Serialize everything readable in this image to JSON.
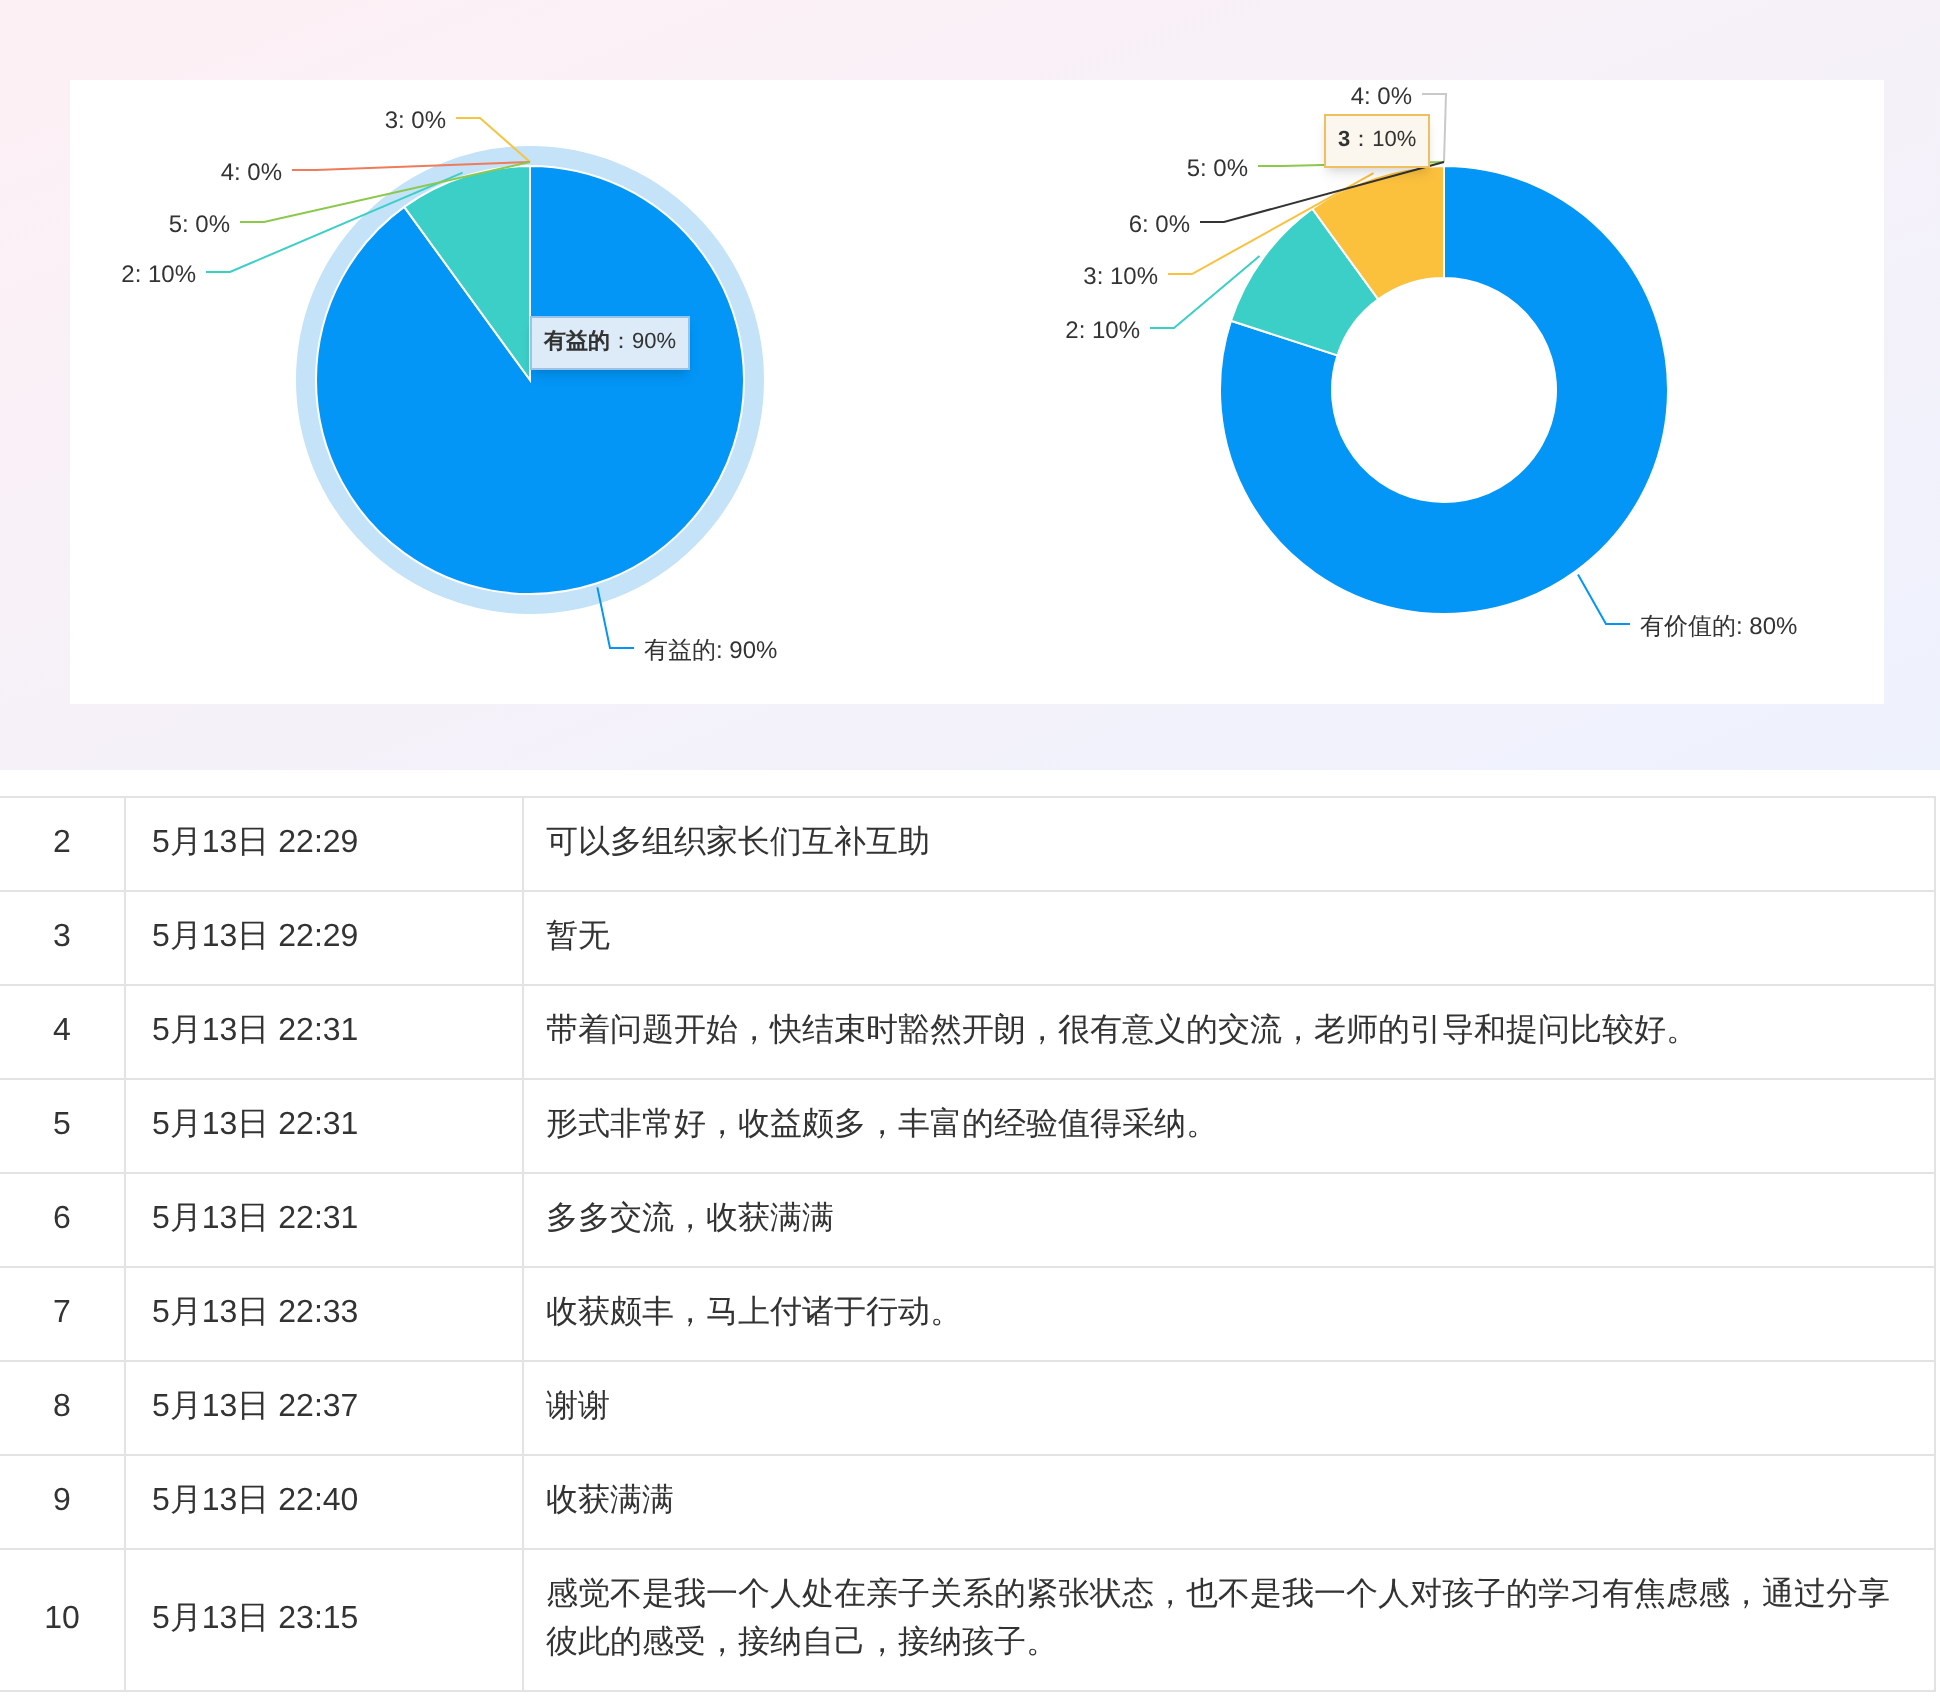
{
  "charts": [
    {
      "chart_data": {
        "type": "pie",
        "values": [
          90,
          10,
          0,
          0,
          0
        ]
      },
      "slices": [
        {
          "label": "有益的: 90%",
          "color": "#0396f7",
          "highlighted": true
        },
        {
          "label": "2: 10%",
          "color": "#3ccfc8",
          "highlighted": false
        },
        {
          "label": "3: 0%",
          "color": "#f5c542",
          "highlighted": false
        },
        {
          "label": "4: 0%",
          "color": "#ef7b5a",
          "highlighted": false
        },
        {
          "label": "5: 0%",
          "color": "#8cc84b",
          "highlighted": false
        }
      ],
      "tooltip": "**有益的**：90%"
    },
    {
      "chart_data": {
        "type": "donut",
        "values": [
          80,
          10,
          10,
          0,
          0,
          0
        ]
      },
      "slices": [
        {
          "label": "有价值的: 80%",
          "color": "#0396f7"
        },
        {
          "label": "2: 10%",
          "color": "#3ccfc8"
        },
        {
          "label": "3: 10%",
          "color": "#fbc13d"
        },
        {
          "label": "4: 0%",
          "color": "#c9c9c9"
        },
        {
          "label": "5: 0%",
          "color": "#8cc84b"
        },
        {
          "label": "6: 0%",
          "color": "#333333"
        }
      ],
      "tooltip": "**3**：10%"
    }
  ],
  "table": {
    "rows": [
      {
        "number": "2",
        "time": "5月13日 22:29",
        "comment": "可以多组织家长们互补互助"
      },
      {
        "number": "3",
        "time": "5月13日 22:29",
        "comment": "暂无"
      },
      {
        "number": "4",
        "time": "5月13日 22:31",
        "comment": "带着问题开始，快结束时豁然开朗，很有意义的交流，老师的引导和提问比较好。"
      },
      {
        "number": "5",
        "time": "5月13日 22:31",
        "comment": "形式非常好，收益颇多，丰富的经验值得采纳。"
      },
      {
        "number": "6",
        "time": "5月13日 22:31",
        "comment": "多多交流，收获满满"
      },
      {
        "number": "7",
        "time": "5月13日 22:33",
        "comment": "收获颇丰，马上付诸于行动。"
      },
      {
        "number": "8",
        "time": "5月13日 22:37",
        "comment": "谢谢"
      },
      {
        "number": "9",
        "time": "5月13日 22:40",
        "comment": "收获满满"
      },
      {
        "number": "10",
        "time": "5月13日 23:15",
        "comment": "感觉不是我一个人处在亲子关系的紧张状态，也不是我一个人对孩子的学习有焦虑感，通过分享彼此的感受，接纳自己，接纳孩子。"
      }
    ]
  }
}
